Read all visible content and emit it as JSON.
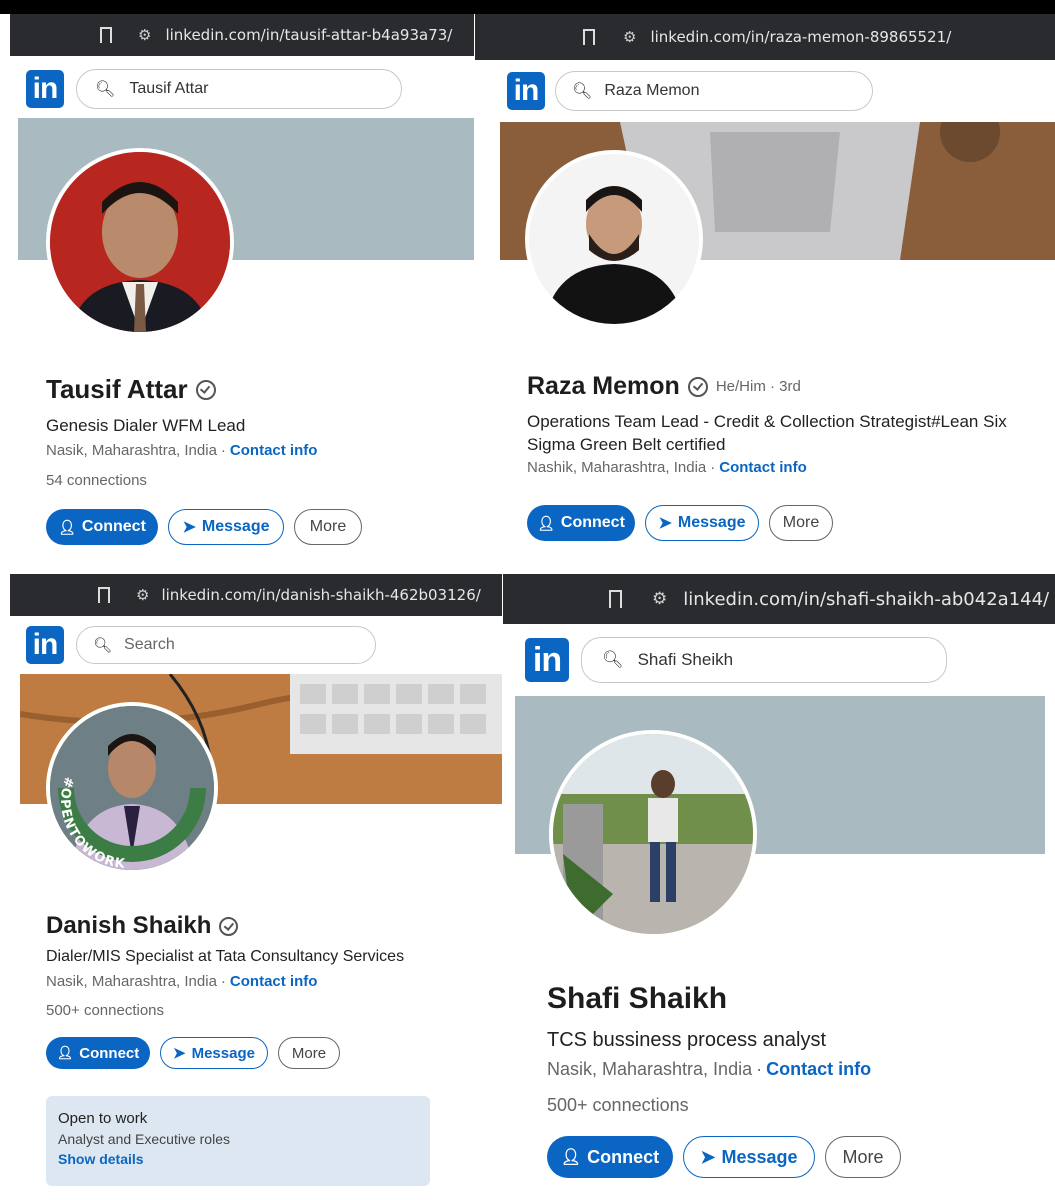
{
  "brand": {
    "logo_text": "in",
    "color": "#0a66c2"
  },
  "profiles": [
    {
      "url": "linkedin.com/in/tausif-attar-b4a93a73/",
      "search_value": "Tausif Attar",
      "name": "Tausif Attar",
      "pronouns": "",
      "headline": "Genesis Dialer WFM Lead",
      "location": "Nasik, Maharashtra, India",
      "contact_label": "Contact info",
      "connections": "54 connections",
      "buttons": {
        "connect": "Connect",
        "message": "Message",
        "more": "More"
      }
    },
    {
      "url": "linkedin.com/in/raza-memon-89865521/",
      "search_value": "Raza Memon",
      "name": "Raza Memon",
      "pronouns": "He/Him · 3rd",
      "headline": "Operations Team Lead - Credit & Collection Strategist#Lean Six Sigma Green Belt certified",
      "location": "Nashik, Maharashtra, India",
      "contact_label": "Contact info",
      "connections": "",
      "buttons": {
        "connect": "Connect",
        "message": "Message",
        "more": "More"
      }
    },
    {
      "url": "linkedin.com/in/danish-shaikh-462b03126/",
      "search_value": "",
      "search_placeholder": "Search",
      "name": "Danish Shaikh",
      "pronouns": "",
      "headline": "Dialer/MIS Specialist at Tata Consultancy Services",
      "location": "Nasik, Maharashtra, India",
      "contact_label": "Contact info",
      "connections": "500+ connections",
      "open_to_work_ring": "#OPENTOWORK",
      "open_to_work": {
        "title": "Open to work",
        "roles": "Analyst and Executive roles",
        "link": "Show details"
      },
      "buttons": {
        "connect": "Connect",
        "message": "Message",
        "more": "More"
      }
    },
    {
      "url": "linkedin.com/in/shafi-shaikh-ab042a144/",
      "search_value": "Shafi Sheikh",
      "name": "Shafi Shaikh",
      "pronouns": "",
      "headline": "TCS bussiness process analyst",
      "location": "Nasik, Maharashtra, India",
      "contact_label": "Contact info",
      "connections": "500+ connections",
      "buttons": {
        "connect": "Connect",
        "message": "Message",
        "more": "More"
      }
    }
  ]
}
